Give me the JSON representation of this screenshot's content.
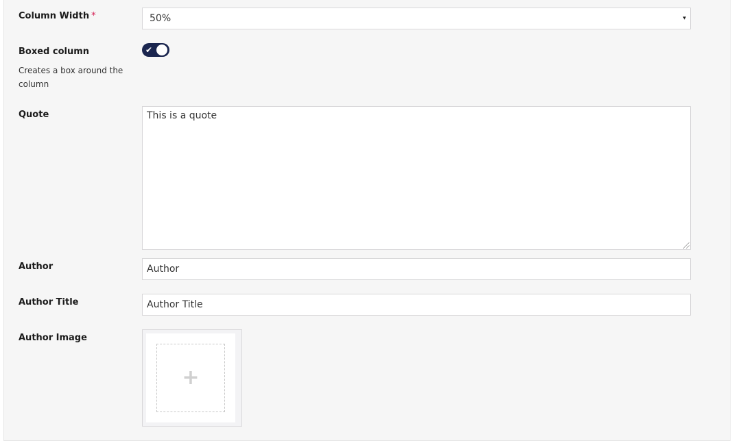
{
  "fields": {
    "column_width": {
      "label": "Column Width",
      "required_mark": "*",
      "value": "50%",
      "caret": "▾"
    },
    "boxed_column": {
      "label": "Boxed column",
      "description": "Creates a box around the column",
      "checked": true,
      "check_glyph": "✔"
    },
    "quote": {
      "label": "Quote",
      "value": "This is a quote"
    },
    "author": {
      "label": "Author",
      "placeholder": "Author"
    },
    "author_title": {
      "label": "Author Title",
      "placeholder": "Author Title"
    },
    "author_image": {
      "label": "Author Image",
      "add_glyph": "+"
    }
  },
  "colors": {
    "toggle_on": "#1b264f",
    "required": "#d42054",
    "panel_bg": "#f6f6f6"
  }
}
